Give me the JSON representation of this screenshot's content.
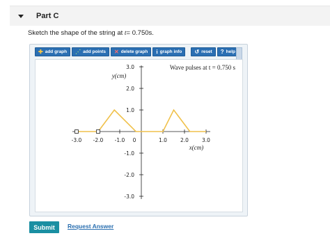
{
  "part": {
    "title": "Part C"
  },
  "prompt": {
    "before": "Sketch the shape of the string at ",
    "var": "t",
    "after": "= 0.750s."
  },
  "toolbar": {
    "add_graph": "add graph",
    "add_points": "add points",
    "delete_graph": "delete graph",
    "graph_info": "graph info",
    "reset": "reset",
    "help": "help"
  },
  "chart_data": {
    "type": "line",
    "title": "Wave pulses at t = 0.750 s",
    "xlabel": "x(cm)",
    "ylabel": "y(cm)",
    "xlim": [
      -3.0,
      3.0
    ],
    "ylim": [
      -3.0,
      3.0
    ],
    "x_ticks": [
      "-3.0",
      "-2.0",
      "-1.0",
      "0",
      "1.0",
      "2.0",
      "3.0"
    ],
    "y_ticks": [
      "3.0",
      "2.0",
      "1.0",
      "-1.0",
      "-2.0",
      "-3.0"
    ],
    "series": [
      {
        "color": "#f0c14b",
        "points": [
          [
            -2.0,
            0
          ],
          [
            -1.25,
            1.0
          ],
          [
            -0.25,
            0
          ],
          [
            0,
            0
          ],
          [
            1.0,
            0
          ],
          [
            1.5,
            1.0
          ],
          [
            2.25,
            0
          ],
          [
            3.0,
            0
          ]
        ]
      },
      {
        "color": "#f0c14b",
        "points": [
          [
            -3.0,
            0
          ],
          [
            -2.0,
            0
          ]
        ]
      }
    ],
    "handles": [
      [
        -3.0,
        0
      ],
      [
        -2.0,
        0
      ]
    ]
  },
  "actions": {
    "submit": "Submit",
    "request": "Request Answer"
  }
}
